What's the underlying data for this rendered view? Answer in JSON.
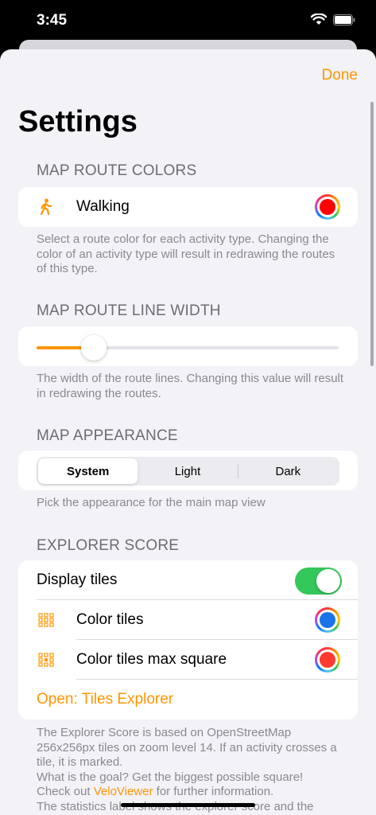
{
  "status": {
    "time": "3:45"
  },
  "nav": {
    "done": "Done"
  },
  "title": "Settings",
  "route_colors": {
    "header": "MAP ROUTE COLORS",
    "walking_label": "Walking",
    "walking_color": "#ff0000",
    "footer": "Select a route color for each activity type. Changing the color of an activity type will result in redrawing the routes of this type."
  },
  "line_width": {
    "header": "MAP ROUTE LINE WIDTH",
    "value_fraction": 0.19,
    "footer": "The width of the route lines. Changing this value will result in redrawing the routes."
  },
  "appearance": {
    "header": "MAP APPEARANCE",
    "options": [
      "System",
      "Light",
      "Dark"
    ],
    "selected": "System",
    "footer": "Pick the appearance for the main map view"
  },
  "explorer": {
    "header": "EXPLORER SCORE",
    "display_tiles_label": "Display tiles",
    "display_tiles_on": true,
    "color_tiles_label": "Color tiles",
    "color_tiles_color": "#1a73e8",
    "color_max_square_label": "Color tiles max square",
    "color_max_square_color": "#ff3b30",
    "open_link": "Open: Tiles Explorer",
    "footer_line1": "The Explorer Score is based on OpenStreetMap 256x256px tiles on zoom level 14. If an activity crosses a tile, it is marked.",
    "footer_line2": "What is the goal? Get the biggest possible square!",
    "footer_line3_pre": "Check out ",
    "footer_line3_link": "VeloViewer",
    "footer_line3_post": " for further information.",
    "footer_line4": "The statistics label shows the explorer score and the"
  },
  "colors": {
    "accent": "#ff9500",
    "toggle_on": "#34c759"
  }
}
